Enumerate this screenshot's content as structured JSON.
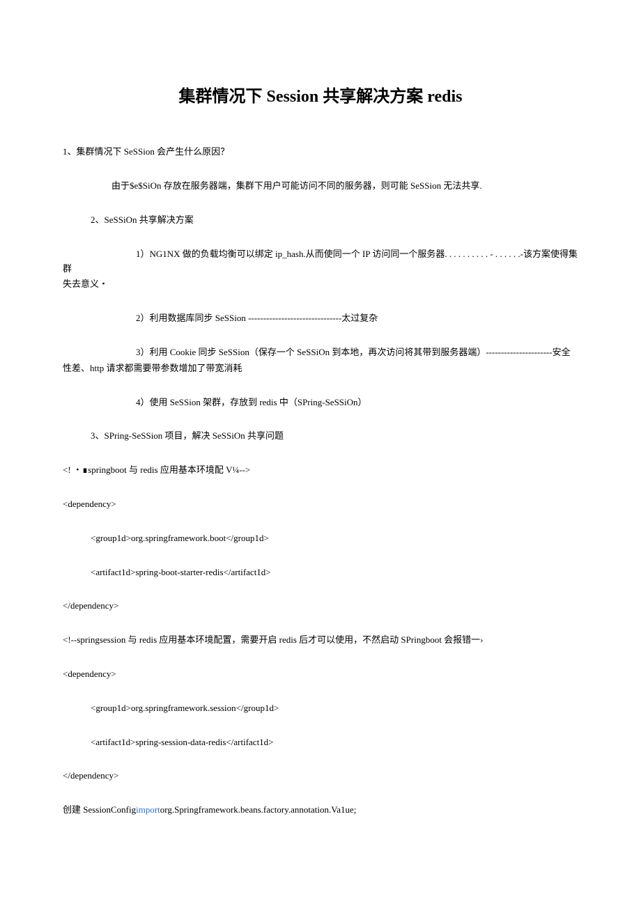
{
  "title": {
    "t1": "集群情况下 ",
    "t2": "Session",
    "t3": " 共享解决方案 ",
    "t4": "redis"
  },
  "q1": "1、集群情况下 SeSSion 会产生什么原因？",
  "a1": "由于$e$SiOn 存放在服务器端，集群下用户可能访问不同的服务器，则可能 SeSSion 无法共享.",
  "h2": "2、SeSSiOn 共享解决方案",
  "sol1a": "1）NG1NX 做的负载均衡可以绑定 ip_hash.从而使同一个 IP 访问同一个服务器. . . . . . . . . . - . . . . . .-该方案使得集群",
  "sol1b": "失去意义・",
  "sol2": "2）利用数据库同步 SeSSion -------------------------------太过复杂",
  "sol3a": "3）利用 Cookie 同步 SeSSion（保存一个 SeSSiOn 到本地，再次访问将其带到服务器端）----------------------安全",
  "sol3b": "性差、http 请求都需要带参数增加了带宽消耗",
  "sol4": "4）使用 SeSSion 架群，存放到 redis 中（SPring-SeSSiOn）",
  "h3": "3、SPring-SeSSion 项目，解决 SeSSiOn 共享问题",
  "c1": "<! ・∎springboot 与 redis 应用基本环境配 V¼-->",
  "c2": "<dependency>",
  "c3": "<group1d>org.springframework.boot</group1d>",
  "c4": "<artifact1d>spring-boot-starter-redis</artifact1d>",
  "c5": "</dependency>",
  "c6": "<!--springsession 与 redis 应用基本环境配置，需要开启 redis 后才可以使用，不然启动 SPringboot 会报错一›",
  "c7": "<dependency>",
  "c8": "<group1d>org.springframework.session</group1d>",
  "c9": "<artifact1d>spring-session-data-redis</artifact1d>",
  "c10": "</dependency>",
  "c11a": "创建 SessionConfig",
  "c11b": "import",
  "c11c": "org.Springframework.beans.factory.annotation.Va1ue;"
}
